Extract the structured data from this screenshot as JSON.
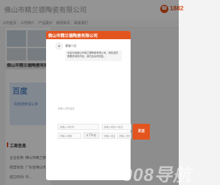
{
  "background": {
    "company_name": "佛山市精兰德陶瓷有限公司",
    "phone": "1882",
    "nav": [
      "公司首页",
      "公司简介",
      "产品展示",
      "新闻资讯",
      "联系我们"
    ],
    "sidebar_title": "佛山市精兰德陶瓷有限公司",
    "baidu_logo": "百度",
    "baidu_sub": "百度搜索请认准",
    "info_title": "工商信息",
    "info_lines": [
      "企业名称: 佛山市精兰德陶瓷有限公司",
      "经营状态: 广东省佛山市...",
      "成立时间: 中..."
    ],
    "watermark": "008导航"
  },
  "chat": {
    "header_title": "佛山市精兰德陶瓷有限公司",
    "agent_name": "客服人员",
    "greeting": "欢迎光临佛山市精兰德陶瓷有限公司，请发送您需要咨询的内容，我们会及时回复。",
    "message_placeholder": "请输入您的留言",
    "fields": {
      "phone": "请输入手机号",
      "name": "请输入联系人姓名",
      "email": "请输入邮箱",
      "code": "请输入验证码",
      "company": "请输入您的公司"
    },
    "captcha_text": "x7kq",
    "submit_label": "发送"
  },
  "colors": {
    "accent": "#e3541f",
    "overlay": "rgba(0,0,0,0.42)"
  }
}
